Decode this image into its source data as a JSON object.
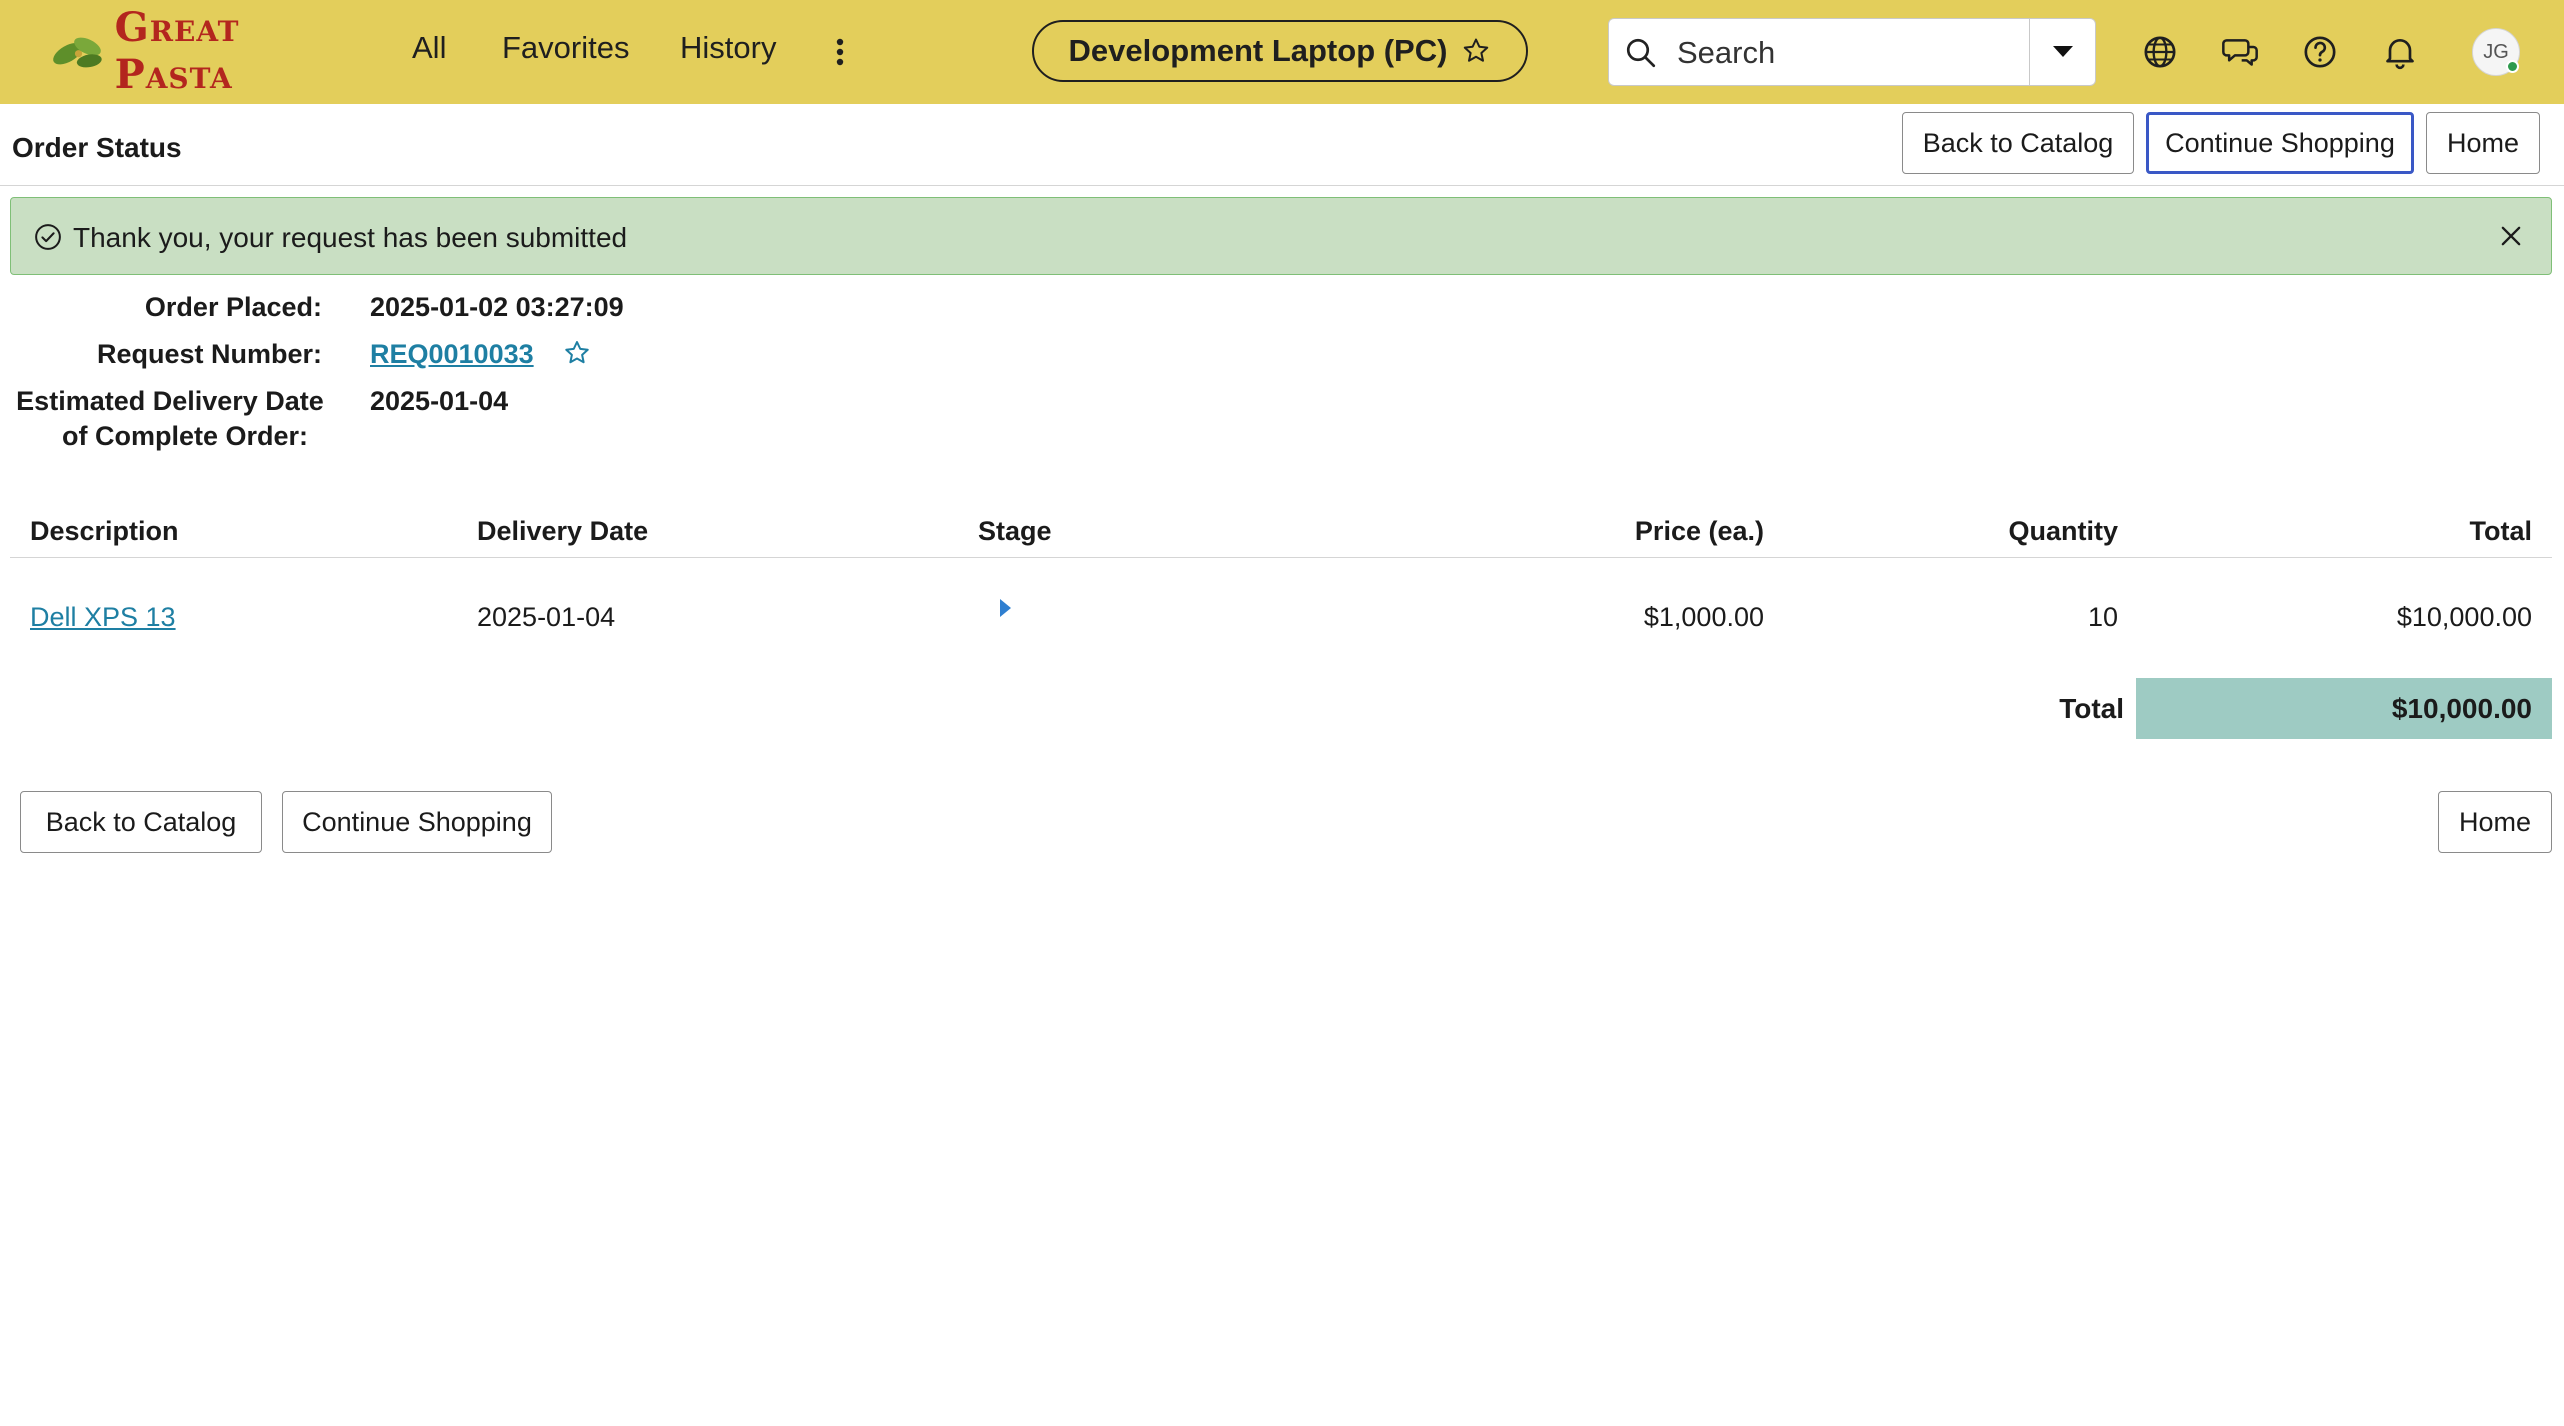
{
  "header": {
    "logo_text": "Great Pasta",
    "nav": {
      "all": "All",
      "favorites": "Favorites",
      "history": "History"
    },
    "context_pill": "Development Laptop (PC)",
    "search": {
      "placeholder": "Search"
    },
    "avatar_initials": "JG",
    "icons": [
      "globe-icon",
      "chat-icon",
      "help-icon",
      "bell-icon"
    ]
  },
  "subheader": {
    "title": "Order Status",
    "buttons": {
      "back": "Back to Catalog",
      "continue": "Continue Shopping",
      "home": "Home"
    }
  },
  "alert": {
    "message": "Thank you, your request has been submitted"
  },
  "details": {
    "order_placed_label": "Order Placed:",
    "order_placed": "2025-01-02 03:27:09",
    "request_number_label": "Request Number:",
    "request_number": "REQ0010033",
    "estimated_label_line1": "Estimated Delivery Date",
    "estimated_label_line2": "of Complete Order:",
    "estimated_delivery": "2025-01-04"
  },
  "table": {
    "columns": {
      "description": "Description",
      "delivery_date": "Delivery Date",
      "stage": "Stage",
      "price": "Price (ea.)",
      "quantity": "Quantity",
      "total": "Total"
    },
    "rows": [
      {
        "description": "Dell XPS 13",
        "delivery_date": "2025-01-04",
        "price": "$1,000.00",
        "quantity": "10",
        "total": "$10,000.00"
      }
    ],
    "total_label": "Total",
    "grand_total": "$10,000.00"
  },
  "footer": {
    "buttons": {
      "back": "Back to Catalog",
      "continue": "Continue Shopping",
      "home": "Home"
    }
  },
  "colors": {
    "header_bg": "#e3ce5b",
    "alert_bg": "#c9dfc3",
    "link": "#1e7fa3",
    "total_bg": "#9ecbc3",
    "focus": "#3a58c6"
  }
}
